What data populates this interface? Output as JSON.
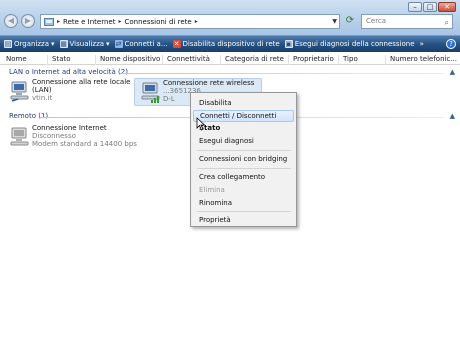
{
  "address": {
    "crumbs": [
      "Rete e Internet",
      "Connessioni di rete"
    ]
  },
  "search": {
    "placeholder": "Cerca"
  },
  "window_buttons": {
    "minimize": "–",
    "maximize": "□",
    "close": "✕"
  },
  "toolbar": {
    "items": [
      {
        "label": "Organizza",
        "icon": "organize-icon"
      },
      {
        "label": "Visualizza",
        "icon": "views-icon"
      },
      {
        "label": "Connetti a...",
        "icon": "connect-icon"
      },
      {
        "label": "Disabilita dispositivo di rete",
        "icon": "disable-device-icon"
      },
      {
        "label": "Esegui diagnosi della connessione",
        "icon": "diagnose-icon"
      }
    ],
    "more": "»"
  },
  "columns": [
    "Nome",
    "Stato",
    "Nome dispositivo",
    "Connettività",
    "Categoria di rete",
    "Proprietario",
    "Tipo",
    "Numero telefonic..."
  ],
  "groups": {
    "lan": {
      "label": "LAN o Internet ad alta velocità (2)",
      "items": [
        {
          "title": "Connessione alla rete locale",
          "line2": "(LAN)",
          "line3": "vtin.it",
          "icon": "lan-computer-icon"
        },
        {
          "title": "Connessione rete wireless",
          "line2": "...3651236",
          "line3": "D-L",
          "icon": "wireless-computer-icon"
        }
      ]
    },
    "remote": {
      "label": "Remoto (1)",
      "items": [
        {
          "title": "Connessione Internet",
          "line2": "Disconnesso",
          "line3": "Modem standard a 14400 bps",
          "icon": "modem-computer-icon"
        }
      ]
    }
  },
  "context_menu": {
    "items": [
      "Disabilita",
      "Connetti / Disconnetti",
      "Stato",
      "Esegui diagnosi",
      "Connessioni con bridging",
      "Crea collegamento",
      "Elimina",
      "Rinomina",
      "Proprietà"
    ],
    "hovered": "Connetti / Disconnetti",
    "default_item": "Stato",
    "disabled": [
      "Elimina"
    ]
  },
  "colors": {
    "commandbar": "#25507f",
    "group_label": "#1e3c78",
    "menu_hover": "#d1e4fb"
  }
}
